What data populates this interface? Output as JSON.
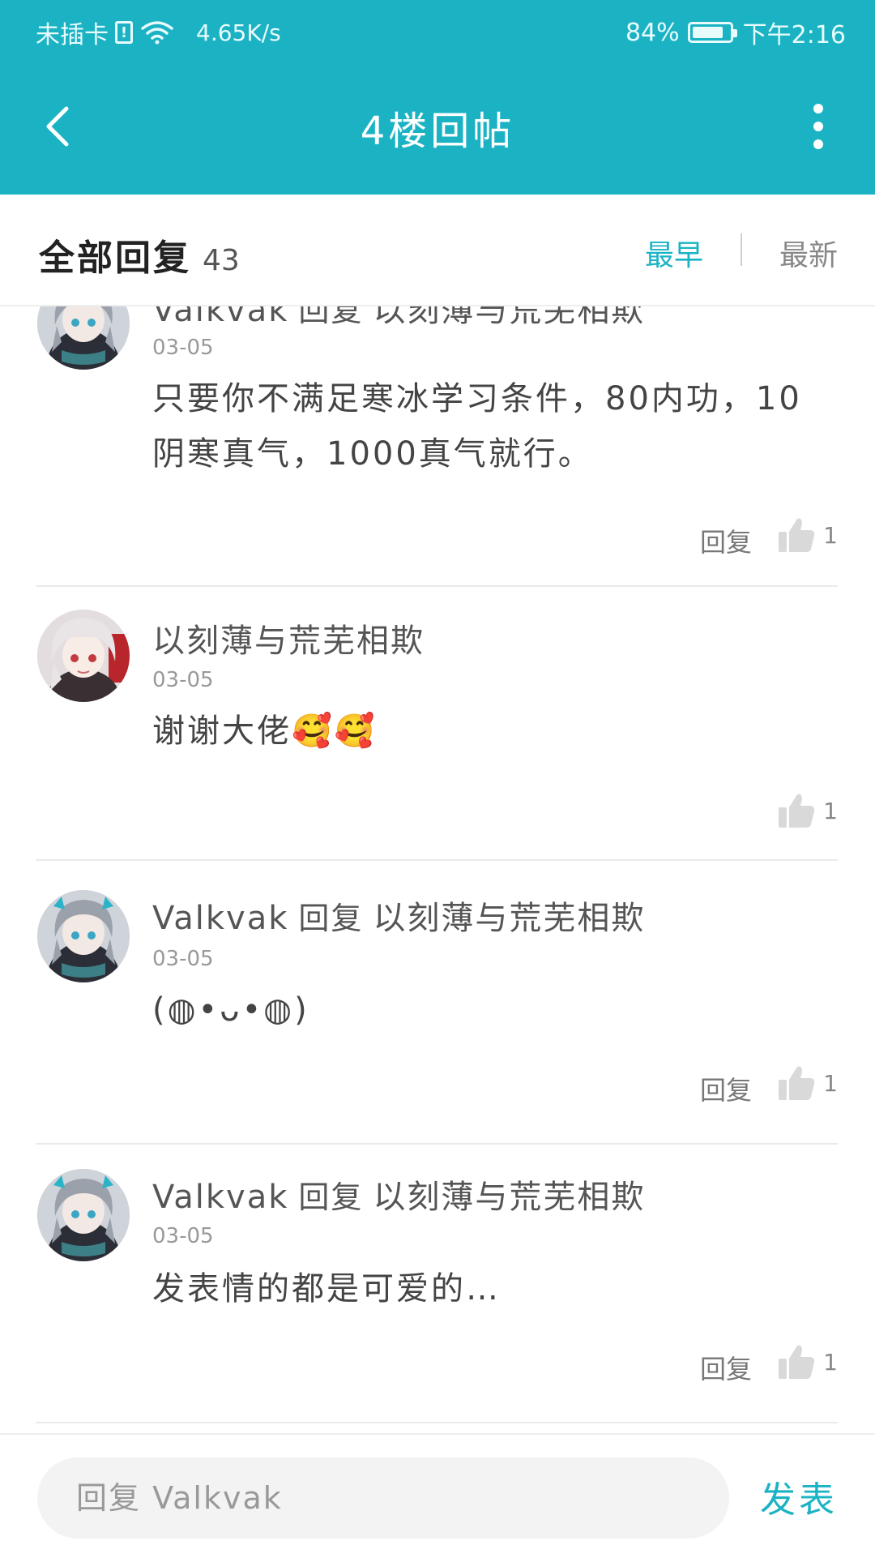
{
  "status_bar": {
    "carrier": "未插卡",
    "speed": "4.65K/s",
    "battery": "84%",
    "battery_level": 0.84,
    "time": "下午2:16"
  },
  "header": {
    "title": "4楼回帖"
  },
  "sort": {
    "label": "全部回复",
    "count": "43",
    "earliest": "最早",
    "newest": "最新"
  },
  "replies": [
    {
      "author": "Valkvak",
      "reply_word": "回复",
      "reply_to": "以刻薄与荒芜相欺",
      "date": "03-05",
      "content": "只要你不满足寒冰学习条件，80内功，10阴寒真气，1000真气就行。",
      "reply_label": "回复",
      "likes": "1"
    },
    {
      "author": "以刻薄与荒芜相欺",
      "date": "03-05",
      "content": "谢谢大佬🥰🥰",
      "likes": "1"
    },
    {
      "author": "Valkvak",
      "reply_word": "回复",
      "reply_to": "以刻薄与荒芜相欺",
      "date": "03-05",
      "content": "(◍•ᴗ•◍)",
      "reply_label": "回复",
      "likes": "1"
    },
    {
      "author": "Valkvak",
      "reply_word": "回复",
      "reply_to": "以刻薄与荒芜相欺",
      "date": "03-05",
      "content": "发表情的都是可爱的…",
      "reply_label": "回复",
      "likes": "1"
    }
  ],
  "composer": {
    "placeholder": "回复 Valkvak",
    "submit": "发表"
  },
  "colors": {
    "accent": "#1bb3c4"
  }
}
